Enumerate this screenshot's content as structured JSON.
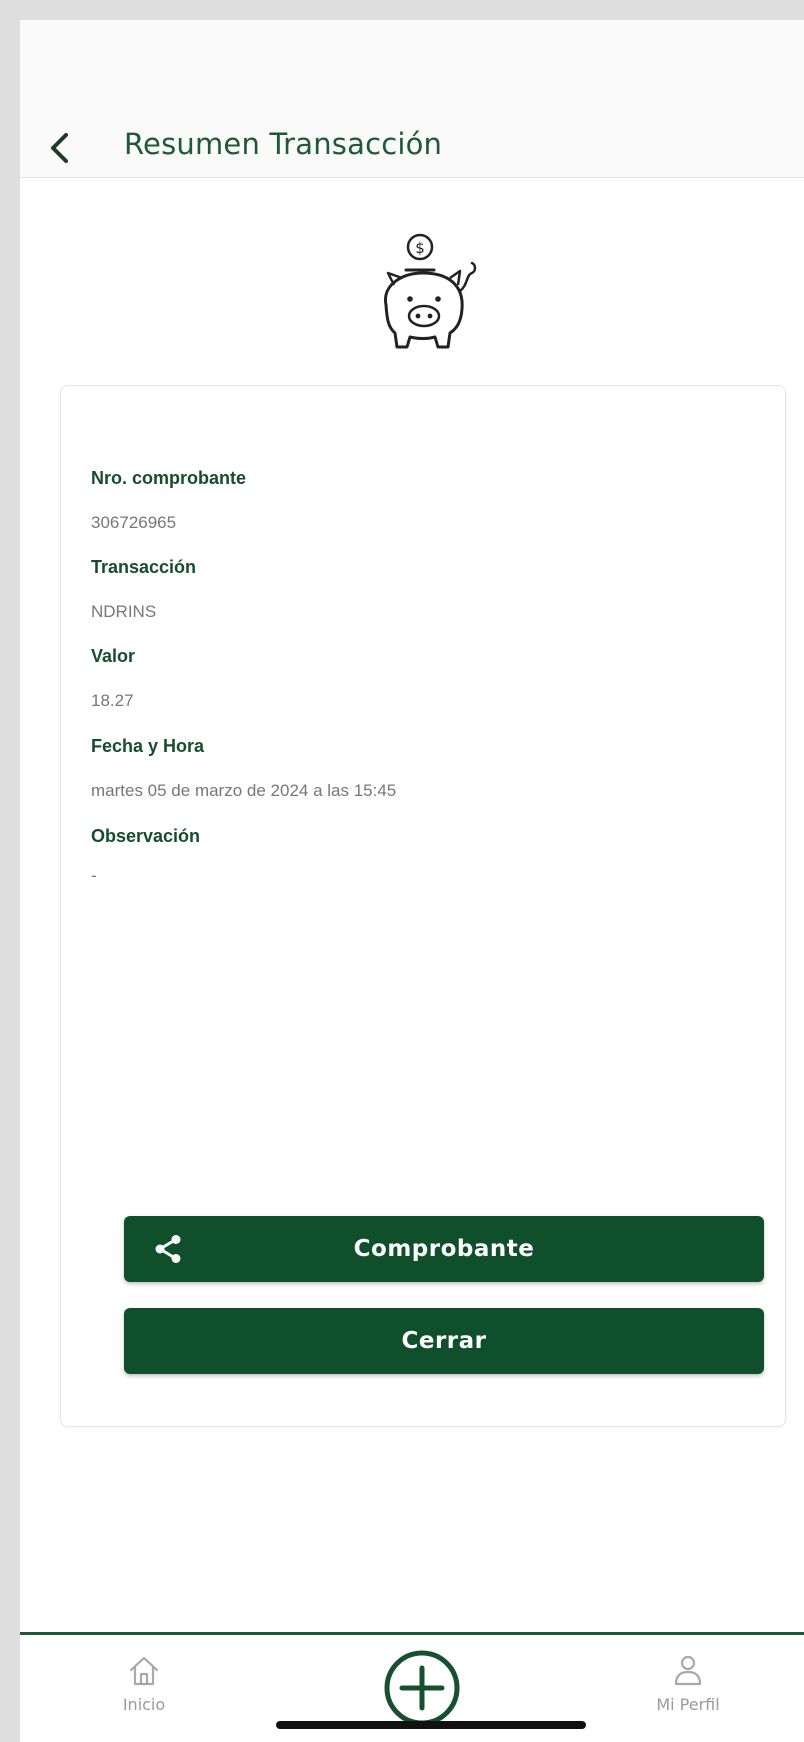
{
  "header": {
    "title": "Resumen Transacción",
    "back_icon": "chevron-left-icon"
  },
  "hero_icon": "piggy-bank-coin-icon",
  "details": [
    {
      "label": "Nro. comprobante",
      "value": "306726965"
    },
    {
      "label": "Transacción",
      "value": "NDRINS"
    },
    {
      "label": "Valor",
      "value": "18.27"
    },
    {
      "label": "Fecha y Hora",
      "value": "martes 05 de marzo de 2024 a las  15:45"
    },
    {
      "label": "Observación",
      "value": "-"
    }
  ],
  "buttons": {
    "receipt_label": "Comprobante",
    "receipt_icon": "share-icon",
    "close_label": "Cerrar"
  },
  "bottom_nav": {
    "home_label": "Inicio",
    "home_icon": "home-icon",
    "add_icon": "plus-circle-icon",
    "profile_label": "Mi Perfil",
    "profile_icon": "user-icon"
  },
  "colors": {
    "primary": "#0f4f2b",
    "heading": "#1f5a37",
    "muted": "#9a9a9a"
  }
}
